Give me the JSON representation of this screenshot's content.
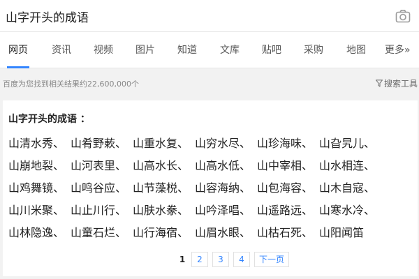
{
  "search": {
    "query": "山字开头的成语",
    "camera_icon": "camera-icon"
  },
  "tabs": [
    {
      "label": "网页",
      "active": true
    },
    {
      "label": "资讯"
    },
    {
      "label": "视频"
    },
    {
      "label": "图片"
    },
    {
      "label": "知道"
    },
    {
      "label": "文库"
    },
    {
      "label": "贴吧"
    },
    {
      "label": "采购"
    },
    {
      "label": "地图"
    },
    {
      "label": "更多»"
    }
  ],
  "result_info": {
    "count_text": "百度为您找到相关结果约22,600,000个",
    "tools_label": "搜索工具",
    "tools_icon": "funnel-icon"
  },
  "card": {
    "title": "山字开头的成语 ：",
    "idioms": [
      "山清水秀、",
      "山肴野蔌、",
      "山重水复、",
      "山穷水尽、",
      "山珍海味、",
      "山旮旯儿、",
      "山崩地裂、",
      "山河表里、",
      "山高水长、",
      "山高水低、",
      "山中宰相、",
      "山水相连、",
      "山鸡舞镜、",
      "山鸣谷应、",
      "山节藻棁、",
      "山容海纳、",
      "山包海容、",
      "山木自寇、",
      "山川米聚、",
      "山止川行、",
      "山肤水豢、",
      "山吟泽唱、",
      "山遥路远、",
      "山寒水冷、",
      "山林隐逸、",
      "山童石烂、",
      "山行海宿、",
      "山眉水眼、",
      "山枯石死、",
      "山阳闻笛"
    ]
  },
  "pagination": {
    "current": "1",
    "pages": [
      "2",
      "3",
      "4"
    ],
    "next_label": "下一页"
  },
  "colors": {
    "accent": "#3385ff",
    "background": "#f2f2f2"
  }
}
